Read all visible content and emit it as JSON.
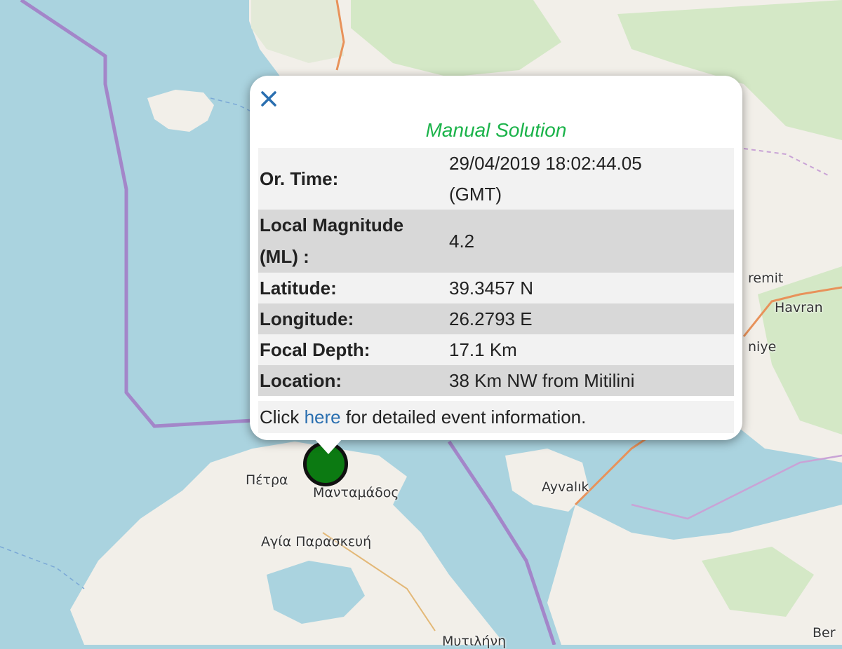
{
  "map": {
    "labels": {
      "petra": "Πέτρα",
      "mantamados": "Μανταμάδος",
      "agia_paraskevi": "Αγία Παρασκευή",
      "ayvalik": "Ayvalık",
      "remit": "remit",
      "havran": "Havran",
      "niye": "niye",
      "mytilini": "Μυτιλήνη",
      "ber": "Ber"
    },
    "colors": {
      "sea": "#aad3df",
      "land": "#f2efe9",
      "forest": "#d4e8c6",
      "border": "#a386c9",
      "road": "#e8925a",
      "marker_fill": "#0c7a12"
    }
  },
  "popup": {
    "close_icon": "close-icon",
    "title": "Manual Solution",
    "rows": [
      {
        "key": "Or. Time:",
        "value_line1": "29/04/2019 18:02:44.05",
        "value_line2": "(GMT)"
      },
      {
        "key_line1": "Local Magnitude",
        "key_line2": "(ML) :",
        "value": "4.2"
      },
      {
        "key": "Latitude:",
        "value": "39.3457 N"
      },
      {
        "key": "Longitude:",
        "value": "26.2793 E"
      },
      {
        "key": "Focal Depth:",
        "value": "17.1 Km"
      },
      {
        "key": "Location:",
        "value": "38 Km NW from Mitilini"
      }
    ],
    "footer": {
      "prefix": "Click ",
      "link": "here",
      "suffix": " for detailed event information."
    }
  }
}
